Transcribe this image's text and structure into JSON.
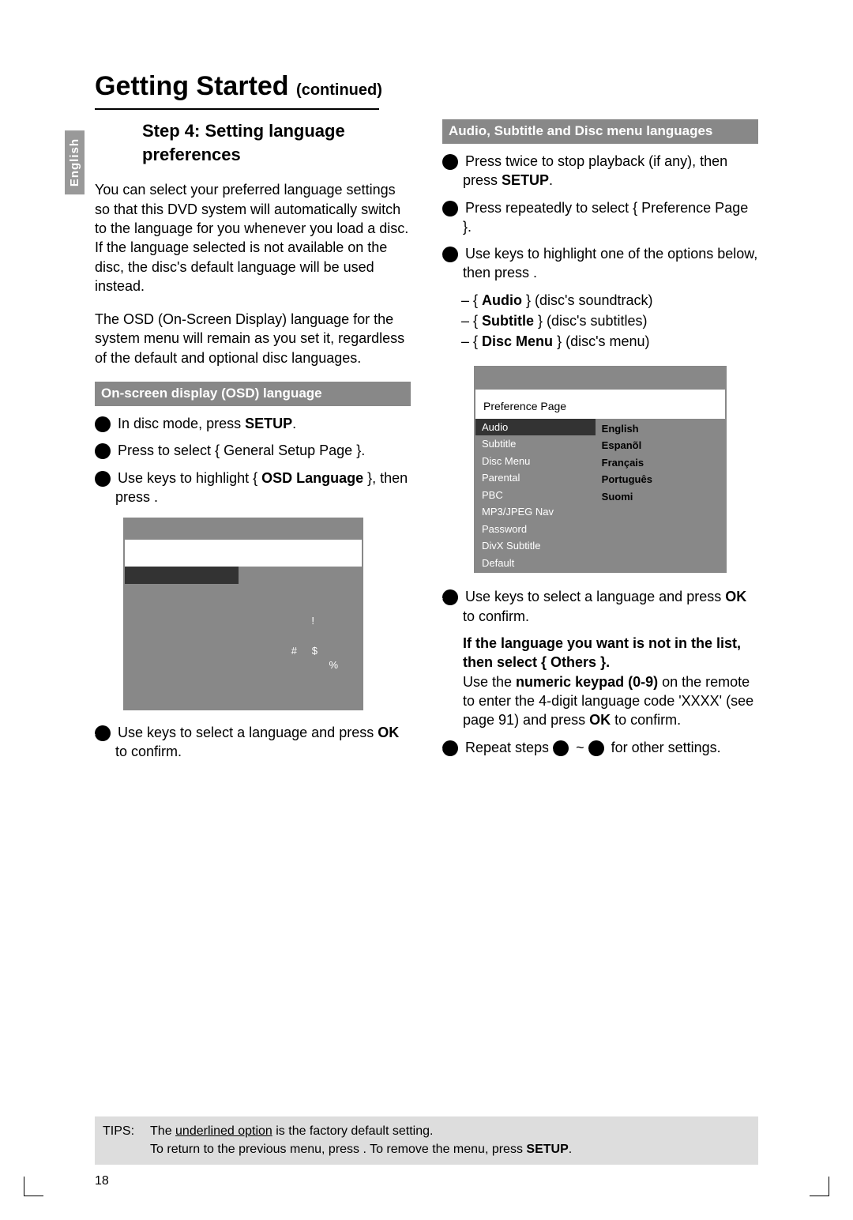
{
  "sideTab": "English",
  "title_main": "Getting Started",
  "title_cont": "(continued)",
  "h2": "Step 4:  Setting language preferences",
  "left": {
    "p1": "You can select your preferred language settings so that this DVD system will automatically switch to the language for you whenever you load a disc.  If the language selected is not available on the disc, the disc's default language will be used instead.",
    "p2": "The OSD (On-Screen Display) language for the system menu will remain as you set it, regardless of the default and optional disc languages.",
    "bar": "On-screen display (OSD) language",
    "s1a": "In disc mode, press ",
    "s1b": "SETUP",
    "s1c": ".",
    "s2a": "Press      to select { General Setup Page }.",
    "s3a": "Use          keys to highlight { ",
    "s3b": "OSD Language",
    "s3c": " }, then press     .",
    "s4a": "Use          keys to select a language and press ",
    "s4b": "OK",
    "s4c": " to confirm."
  },
  "osd_marks": {
    "a": "!",
    "b": "#",
    "c": "$",
    "d": "%"
  },
  "right": {
    "bar": "Audio, Subtitle and Disc menu languages",
    "s1a": "Press      twice to stop playback (if any), then press ",
    "s1b": "SETUP",
    "s1c": ".",
    "s2a": "Press     repeatedly to select { Preference Page }.",
    "s3a": "Use          keys to highlight one of the options below, then press     .",
    "opt1a": "Audio",
    "opt1b": " } (disc's soundtrack)",
    "opt2a": "Subtitle",
    "opt2b": " } (disc's subtitles)",
    "opt3a": "Disc Menu",
    "opt3b": " } (disc's menu)",
    "s4a": "Use          keys to select a language and press ",
    "s4b": "OK",
    "s4c": " to confirm.",
    "p5a": "If the language you want is not in the list, then select ",
    "p5b": "{ Others }",
    "p5c": ".",
    "p6a": "Use the ",
    "p6b": "numeric keypad (0-9)",
    "p6c": " on the remote to enter the 4-digit language code 'XXXX' (see page 91) and press ",
    "p6d": "OK",
    "p6e": " to confirm.",
    "s5a": "Repeat steps ",
    "s5b": " ~ ",
    "s5c": " for other settings."
  },
  "menu": {
    "title": "Preference Page",
    "left": [
      "Audio",
      "Subtitle",
      "Disc Menu",
      "Parental",
      "PBC",
      "MP3/JPEG Nav",
      "Password",
      "DivX Subtitle",
      "Default"
    ],
    "right": [
      "English",
      "Espanõl",
      "Français",
      "Português",
      "Suomi"
    ]
  },
  "tips": {
    "label": "TIPS:",
    "line1a": "The ",
    "line1u": "underlined option",
    "line1b": " is the factory default setting.",
    "line2a": "To return to the previous menu, press     .  To remove the menu, press ",
    "line2b": "SETUP",
    "line2c": "."
  },
  "pageNumber": "18"
}
